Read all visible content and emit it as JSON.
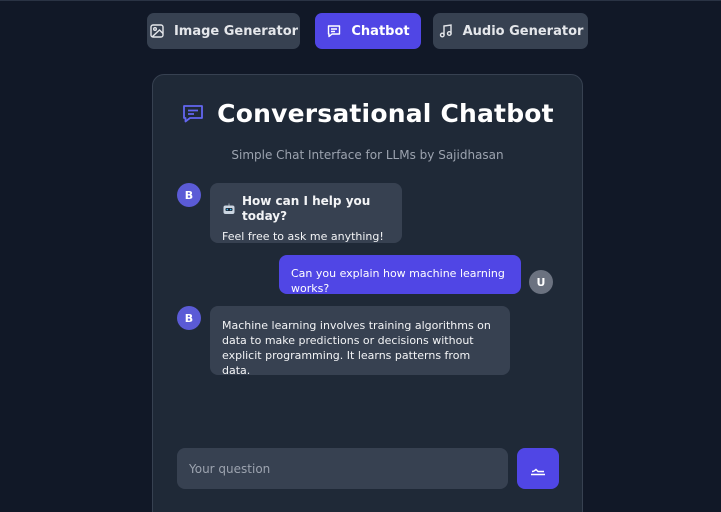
{
  "tabs": [
    {
      "label": "Image Generator",
      "icon": "image-icon",
      "active": false
    },
    {
      "label": "Chatbot",
      "icon": "chat-icon",
      "active": true
    },
    {
      "label": "Audio Generator",
      "icon": "music-note-icon",
      "active": false
    }
  ],
  "chat": {
    "title": "Conversational Chatbot",
    "subtitle": "Simple Chat Interface for LLMs by Sajidhasan",
    "messages": [
      {
        "role": "bot",
        "avatar": "B",
        "heading": "How can I help you today?",
        "text": "Feel free to ask me anything!"
      },
      {
        "role": "user",
        "avatar": "U",
        "text": "Can you explain how machine learning works?"
      },
      {
        "role": "bot",
        "avatar": "B",
        "text": "Machine learning involves training algorithms on data to make predictions or decisions without explicit programming. It learns patterns from data."
      }
    ],
    "input_placeholder": "Your question",
    "input_value": ""
  },
  "colors": {
    "background": "#111827",
    "card": "#1f2937",
    "accent": "#5046e5",
    "bubble_bot": "#374151",
    "avatar_user": "#6b7280"
  }
}
